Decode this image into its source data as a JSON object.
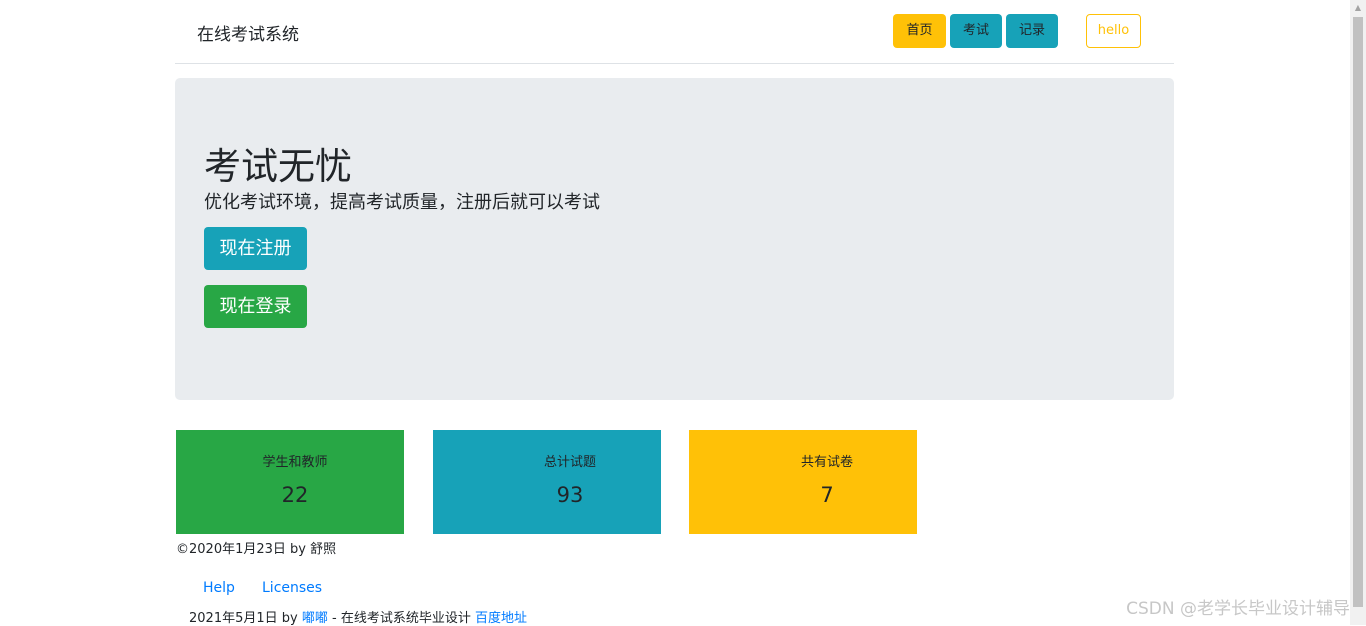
{
  "header": {
    "brand": "在线考试系统",
    "nav": {
      "home": "首页",
      "exam": "考试",
      "record": "记录",
      "user": "hello"
    }
  },
  "hero": {
    "title": "考试无忧",
    "subtitle": "优化考试环境，提高考试质量，注册后就可以考试",
    "register_button": "现在注册",
    "login_button": "现在登录"
  },
  "stats": [
    {
      "label": "学生和教师",
      "value": "22",
      "color": "#28a745"
    },
    {
      "label": "总计试题",
      "value": "93",
      "color": "#17a2b8"
    },
    {
      "label": "共有试卷",
      "value": "7",
      "color": "#ffc107"
    }
  ],
  "footer": {
    "copyright": "©2020年1月23日 by 舒照",
    "links": {
      "help": "Help",
      "licenses": "Licenses"
    },
    "line": {
      "prefix": "2021年5月1日 by ",
      "author": "嘟嘟",
      "middle": " - 在线考试系统毕业设计 ",
      "address": "百度地址"
    }
  },
  "watermark": "CSDN @老学长毕业设计辅导",
  "colors": {
    "warning": "#ffc107",
    "info": "#17a2b8",
    "success": "#28a745",
    "jumbotron": "#e9ecef",
    "link": "#007bff"
  }
}
